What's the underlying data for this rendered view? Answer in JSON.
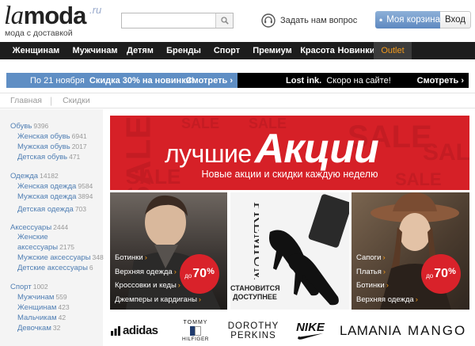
{
  "header": {
    "logo": {
      "la": "la",
      "moda": "moda",
      "ru": ".ru",
      "tagline": "мода с доставкой"
    },
    "search": {
      "placeholder": "",
      "value": ""
    },
    "ask_label": "Задать нам вопрос",
    "cart_label": "Моя корзина",
    "login_label": "Вход"
  },
  "nav": {
    "items": [
      "Женщинам",
      "Мужчинам",
      "Детям",
      "Бренды",
      "Спорт",
      "Премиум",
      "Красота",
      "Новинки",
      "Outlet"
    ],
    "accent": "#f39a1b"
  },
  "promo": {
    "left": {
      "prefix": "По 21 ноября",
      "bold": "Скидка 30% на новинки!",
      "link": "Смотреть",
      "color": "#5f8ec4"
    },
    "right": {
      "bold": "Lost ink.",
      "text": "Скоро на сайте!",
      "link": "Смотреть",
      "color": "#000000"
    }
  },
  "breadcrumb": [
    "Главная",
    "Скидки"
  ],
  "sidebar": {
    "groups": [
      {
        "label": "Обувь",
        "count": "9396",
        "items": [
          {
            "label": "Женская обувь",
            "count": "6941"
          },
          {
            "label": "Мужская обувь",
            "count": "2017"
          },
          {
            "label": "Детская обувь",
            "count": "471"
          }
        ]
      },
      {
        "label": "Одежда",
        "count": "14182",
        "items": [
          {
            "label": "Женская одежда",
            "count": "9584"
          },
          {
            "label": "Мужская одежда",
            "count": "3894"
          },
          {
            "label": "Детская одежда",
            "count": "703"
          }
        ]
      },
      {
        "label": "Аксессуары",
        "count": "2444",
        "items": [
          {
            "label": "Женские",
            "label2": "аксессуары",
            "count": "2175"
          },
          {
            "label": "Мужские аксессуары",
            "count": "348"
          },
          {
            "label": "Детские аксессуары",
            "count": "6"
          }
        ]
      },
      {
        "label": "Спорт",
        "count": "1002",
        "items": [
          {
            "label": "Мужчинам",
            "count": "559"
          },
          {
            "label": "Женщинам",
            "count": "423"
          },
          {
            "label": "Мальчикам",
            "count": "42"
          },
          {
            "label": "Девочкам",
            "count": "32"
          }
        ]
      }
    ]
  },
  "hero": {
    "title_small": "лучшие",
    "title_big": "Акции",
    "subtitle": "Новые акции и скидки каждую неделю",
    "bg_word": "SALE",
    "color": "#d62027"
  },
  "tiles": {
    "men": {
      "links": [
        "Ботинки",
        "Верхняя одежда",
        "Кроссовки и кеды",
        "Джемперы и кардиганы"
      ],
      "badge_prefix": "до",
      "badge_value": "70",
      "badge_pct": "%"
    },
    "premium": {
      "word": "PREMIUM",
      "caption1": "СТАНОВИТСЯ",
      "caption2": "ДОСТУПНЕЕ"
    },
    "women": {
      "links": [
        "Сапоги",
        "Платья",
        "Ботинки",
        "Верхняя одежда"
      ],
      "badge_prefix": "до",
      "badge_value": "70",
      "badge_pct": "%"
    }
  },
  "brands": {
    "adidas": "adidas",
    "tommy1": "TOMMY",
    "tommy2": "HILFIGER",
    "dp1": "DOROTHY",
    "dp2": "PERKINS",
    "nike": "NIKE",
    "lamania": "LAMANIA",
    "mango": "MANGO"
  }
}
